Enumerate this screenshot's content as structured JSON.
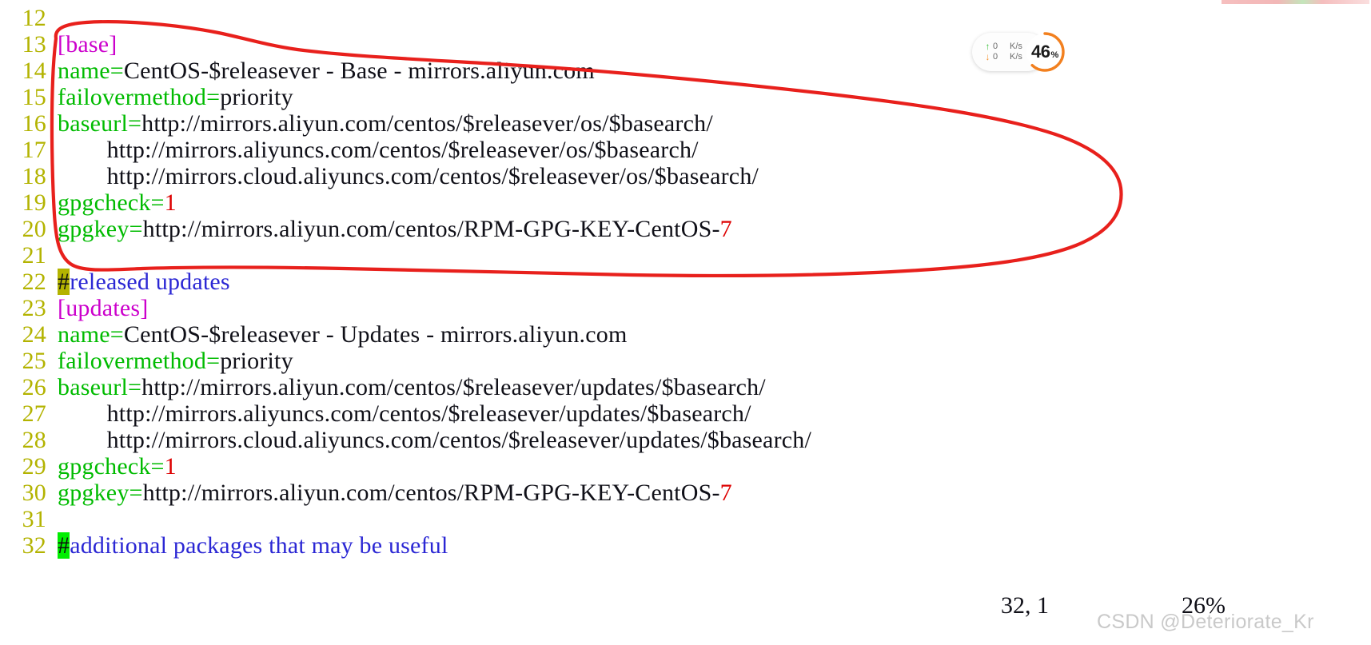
{
  "window": {
    "app": "vim",
    "filetype": "yum-repo-config"
  },
  "top_strip": {
    "label": "clipped-window-edge"
  },
  "editor": {
    "lines": [
      {
        "no": "12",
        "segments": []
      },
      {
        "no": "13",
        "segments": [
          {
            "t": "[base]",
            "c": "sec"
          }
        ]
      },
      {
        "no": "14",
        "segments": [
          {
            "t": "name",
            "c": "key"
          },
          {
            "t": "=",
            "c": "eq"
          },
          {
            "t": "CentOS-$releasever - Base - mirrors.aliyun.com",
            "c": "val"
          }
        ]
      },
      {
        "no": "15",
        "segments": [
          {
            "t": "failovermethod",
            "c": "key"
          },
          {
            "t": "=",
            "c": "eq"
          },
          {
            "t": "priority",
            "c": "val"
          }
        ]
      },
      {
        "no": "16",
        "segments": [
          {
            "t": "baseurl",
            "c": "key"
          },
          {
            "t": "=",
            "c": "eq"
          },
          {
            "t": "http://mirrors.aliyun.com/centos/$releasever/os/$basearch/",
            "c": "val"
          }
        ]
      },
      {
        "no": "17",
        "segments": [
          {
            "t": "        http://mirrors.aliyuncs.com/centos/$releasever/os/$basearch/",
            "c": "val"
          }
        ]
      },
      {
        "no": "18",
        "segments": [
          {
            "t": "        http://mirrors.cloud.aliyuncs.com/centos/$releasever/os/$basearch/",
            "c": "val"
          }
        ]
      },
      {
        "no": "19",
        "segments": [
          {
            "t": "gpgcheck",
            "c": "key"
          },
          {
            "t": "=",
            "c": "eq"
          },
          {
            "t": "1",
            "c": "num"
          }
        ]
      },
      {
        "no": "20",
        "segments": [
          {
            "t": "gpgkey",
            "c": "key"
          },
          {
            "t": "=",
            "c": "eq"
          },
          {
            "t": "http://mirrors.aliyun.com/centos/RPM-GPG-KEY-CentOS-",
            "c": "val"
          },
          {
            "t": "7",
            "c": "num"
          }
        ]
      },
      {
        "no": "21",
        "segments": []
      },
      {
        "no": "22",
        "segments": [
          {
            "t": "#",
            "c": "hash-olive"
          },
          {
            "t": "released updates",
            "c": "cmt"
          }
        ]
      },
      {
        "no": "23",
        "segments": [
          {
            "t": "[updates]",
            "c": "sec"
          }
        ]
      },
      {
        "no": "24",
        "segments": [
          {
            "t": "name",
            "c": "key"
          },
          {
            "t": "=",
            "c": "eq"
          },
          {
            "t": "CentOS-$releasever - Updates - mirrors.aliyun.com",
            "c": "val"
          }
        ]
      },
      {
        "no": "25",
        "segments": [
          {
            "t": "failovermethod",
            "c": "key"
          },
          {
            "t": "=",
            "c": "eq"
          },
          {
            "t": "priority",
            "c": "val"
          }
        ]
      },
      {
        "no": "26",
        "segments": [
          {
            "t": "baseurl",
            "c": "key"
          },
          {
            "t": "=",
            "c": "eq"
          },
          {
            "t": "http://mirrors.aliyun.com/centos/$releasever/updates/$basearch/",
            "c": "val"
          }
        ]
      },
      {
        "no": "27",
        "segments": [
          {
            "t": "        http://mirrors.aliyuncs.com/centos/$releasever/updates/$basearch/",
            "c": "val"
          }
        ]
      },
      {
        "no": "28",
        "segments": [
          {
            "t": "        http://mirrors.cloud.aliyuncs.com/centos/$releasever/updates/$basearch/",
            "c": "val"
          }
        ]
      },
      {
        "no": "29",
        "segments": [
          {
            "t": "gpgcheck",
            "c": "key"
          },
          {
            "t": "=",
            "c": "eq"
          },
          {
            "t": "1",
            "c": "num"
          }
        ]
      },
      {
        "no": "30",
        "segments": [
          {
            "t": "gpgkey",
            "c": "key"
          },
          {
            "t": "=",
            "c": "eq"
          },
          {
            "t": "http://mirrors.aliyun.com/centos/RPM-GPG-KEY-CentOS-",
            "c": "val"
          },
          {
            "t": "7",
            "c": "num"
          }
        ]
      },
      {
        "no": "31",
        "segments": []
      },
      {
        "no": "32",
        "segments": [
          {
            "t": "#",
            "c": "hash-green"
          },
          {
            "t": "additional packages that may be useful",
            "c": "cmt"
          }
        ]
      }
    ]
  },
  "statusline": {
    "cursor_position": "32, 1",
    "scroll_percent": "26%"
  },
  "watermark": {
    "text": "CSDN @Deteriorate_Kr"
  },
  "net_widget": {
    "upload": {
      "icon": "arrow-up-icon",
      "value": "0",
      "unit": "K/s"
    },
    "download": {
      "icon": "arrow-down-icon",
      "value": "0",
      "unit": "K/s"
    },
    "cpu": {
      "value": "46",
      "percent_sign": "%",
      "ring_color": "#f2801f",
      "ring_fraction": 0.62
    }
  },
  "annotation": {
    "type": "hand-drawn-ellipse",
    "color": "#e8201c",
    "note": "circles the [base] repository block, lines 13-20"
  },
  "colors": {
    "line_number": "#b3b300",
    "section_header": "#cc00cc",
    "config_key": "#00bb00",
    "value_text": "#101018",
    "number_literal": "#dd0000",
    "comment": "#2b27d4",
    "cursor_highlight_olive": "#b3b300",
    "cursor_highlight_green": "#00ee00",
    "annotation_red": "#e8201c"
  }
}
